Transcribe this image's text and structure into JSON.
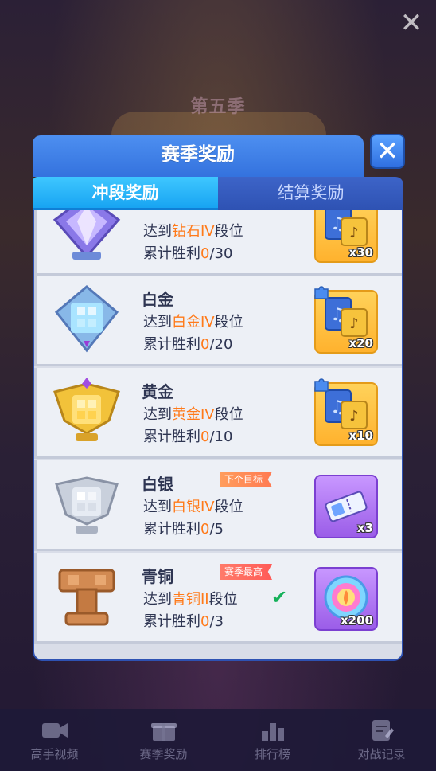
{
  "background": {
    "season_title": "第五季"
  },
  "modal": {
    "title": "赛季奖励",
    "tabs": [
      {
        "label": "冲段奖励",
        "active": true
      },
      {
        "label": "结算奖励",
        "active": false
      }
    ],
    "rows": [
      {
        "tier": "",
        "prefix": "达到",
        "rank": "钻石IV",
        "suffix": "段位",
        "wins_label": "累计胜利",
        "wins_current": "0",
        "wins_total": "/30",
        "reward_count": "x30",
        "reward_type": "music-card",
        "colors": {
          "badge": "#a98cff"
        }
      },
      {
        "tier": "白金",
        "prefix": "达到",
        "rank": "白金IV",
        "suffix": "段位",
        "wins_label": "累计胜利",
        "wins_current": "0",
        "wins_total": "/20",
        "reward_count": "x20",
        "reward_type": "music-card",
        "colors": {
          "badge": "#7fd6ff"
        }
      },
      {
        "tier": "黄金",
        "prefix": "达到",
        "rank": "黄金IV",
        "suffix": "段位",
        "wins_label": "累计胜利",
        "wins_current": "0",
        "wins_total": "/10",
        "reward_count": "x10",
        "reward_type": "music-card",
        "colors": {
          "badge": "#f2c23a"
        }
      },
      {
        "tier": "白银",
        "tag": "下个目标",
        "prefix": "达到",
        "rank": "白银IV",
        "suffix": "段位",
        "wins_label": "累计胜利",
        "wins_current": "0",
        "wins_total": "/5",
        "reward_count": "x3",
        "reward_type": "ticket",
        "colors": {
          "badge": "#c9d0dc"
        }
      },
      {
        "tier": "青铜",
        "tag": "赛季最高",
        "prefix": "达到",
        "rank": "青铜II",
        "suffix": "段位",
        "wins_label": "累计胜利",
        "wins_current": "0",
        "wins_total": "/3",
        "reward_count": "x200",
        "reward_type": "orb",
        "completed": true,
        "colors": {
          "badge": "#d28a52"
        }
      }
    ]
  },
  "bottom_nav": [
    {
      "label": "高手视频",
      "icon": "video-icon"
    },
    {
      "label": "赛季奖励",
      "icon": "gift-icon"
    },
    {
      "label": "排行榜",
      "icon": "leaderboard-icon"
    },
    {
      "label": "对战记录",
      "icon": "record-icon"
    }
  ]
}
